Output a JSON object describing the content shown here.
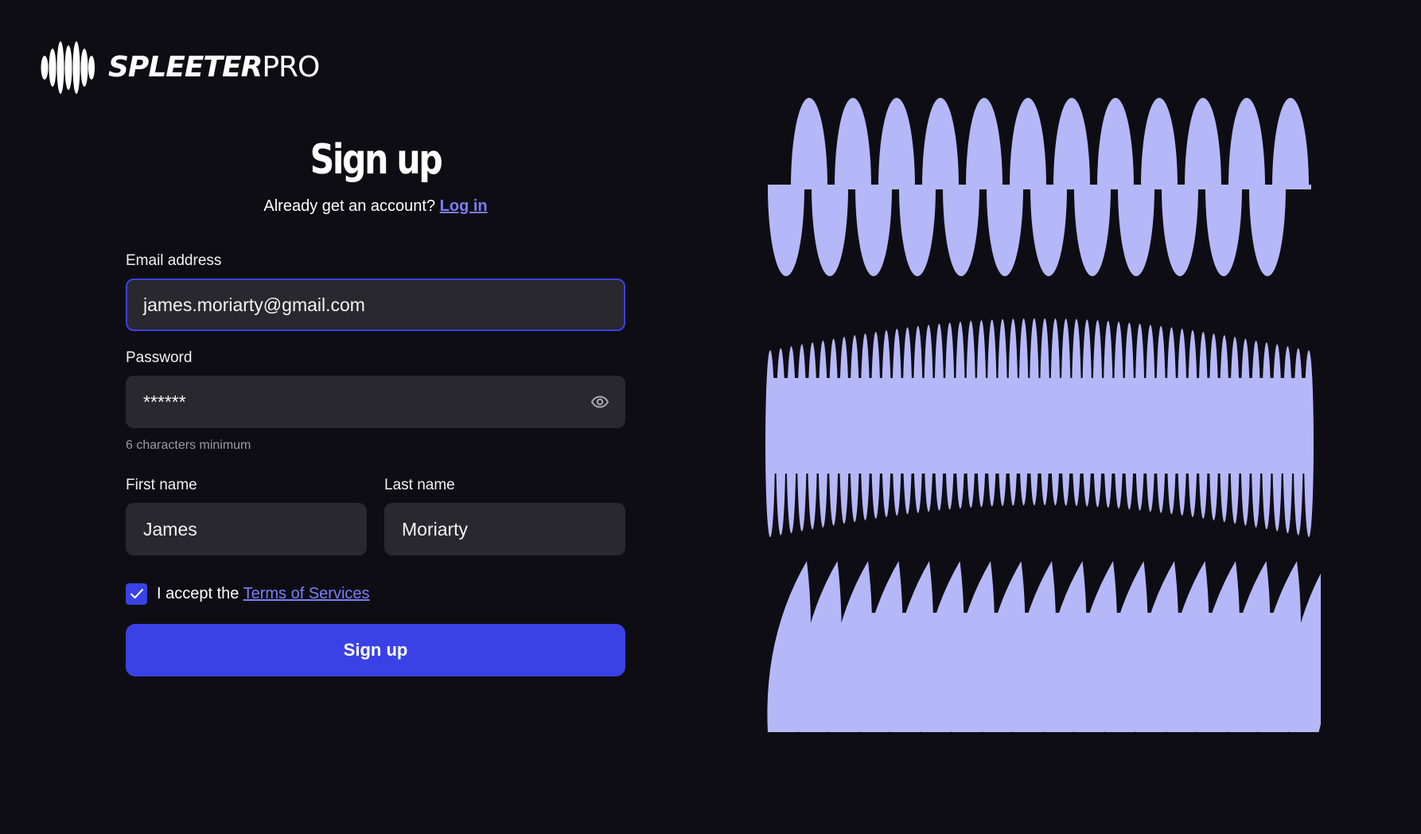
{
  "brand": {
    "name_bold": "SPLEETER",
    "name_light": "PRO"
  },
  "signup": {
    "title": "Sign up",
    "already_text": "Already get an account?",
    "login_link": "Log in",
    "email_label": "Email address",
    "email_value": "james.moriarty@gmail.com",
    "password_label": "Password",
    "password_value": "******",
    "password_hint": "6 characters minimum",
    "first_name_label": "First name",
    "first_name_value": "James",
    "last_name_label": "Last name",
    "last_name_value": "Moriarty",
    "terms_prefix": "I accept the",
    "terms_link": "Terms of Services",
    "terms_checked": true,
    "submit_label": "Sign up"
  },
  "icons": {
    "logo": "soundwave-logo-icon",
    "eye": "eye-icon",
    "check": "check-icon"
  },
  "colors": {
    "background": "#0f0d14",
    "accent": "#3a42e6",
    "link": "#7b7ef5",
    "wave": "#b4b8f8",
    "field": "#29282e"
  }
}
